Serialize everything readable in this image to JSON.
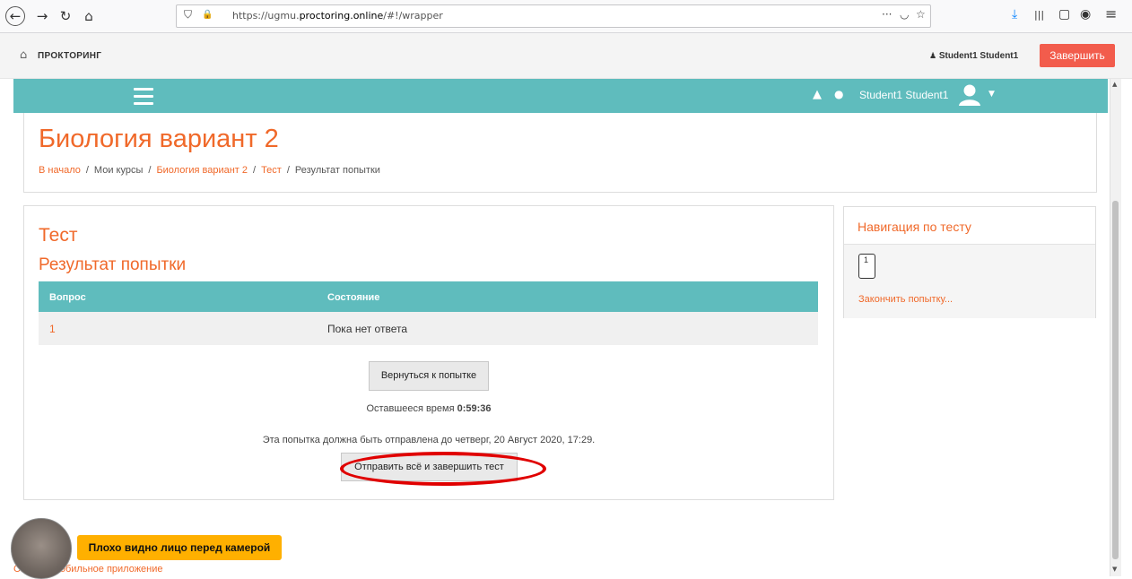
{
  "browser": {
    "url_prefix": "https://ugmu.",
    "url_domain": "proctoring.online",
    "url_suffix": "/#!/wrapper",
    "icons": [
      "back-icon",
      "forward-icon",
      "reload-icon",
      "home-icon",
      "shield-icon",
      "lock-icon",
      "page-actions-icon",
      "pocket-icon",
      "bookmark-star-icon",
      "download-icon",
      "library-icon",
      "sidebar-icon",
      "account-icon",
      "menu-icon"
    ],
    "glyphs": {
      "back": "←",
      "forward": "→",
      "reload": "↻",
      "home": "⌂",
      "more": "···",
      "pocket": "◡",
      "star": "☆",
      "download": "⤓",
      "library": "|||",
      "sidebar": "▢",
      "account": "◉",
      "menu": "≡",
      "shield": "⛉",
      "lock": "🔒"
    }
  },
  "proctor": {
    "title": "ПРОКТОРИНГ",
    "user": "Student1 Student1",
    "finish_label": "Завершить",
    "accent": "#f25c4c"
  },
  "moodle_header": {
    "user_name": "Student1 Student1",
    "color": "#5fbcbd"
  },
  "page": {
    "course_title": "Биология вариант 2",
    "breadcrumb": [
      "В начало",
      "Мои курсы",
      "Биология вариант 2",
      "Тест",
      "Результат попытки"
    ]
  },
  "main": {
    "quiz_title": "Тест",
    "result_title": "Результат попытки",
    "table_headers": [
      "Вопрос",
      "Состояние"
    ],
    "rows": [
      {
        "question": "1",
        "status": "Пока нет ответа"
      }
    ],
    "return_button": "Вернуться к попытке",
    "time_label": "Оставшееся время",
    "time_value": "0:59:36",
    "deadline_text": "Эта попытка должна быть отправлена до четверг, 20 Август 2020, 17:29.",
    "submit_button": "Отправить всё и завершить тест"
  },
  "sidebar": {
    "title": "Навигация по тесту",
    "question_number": "1",
    "finish_link": "Закончить попытку..."
  },
  "footer": {
    "mobile_link": "Скачать мобильное приложение"
  },
  "camera": {
    "warning": "Плохо видно лицо перед камерой",
    "warning_color": "#ffb000"
  },
  "accent_color": "#f0692a"
}
